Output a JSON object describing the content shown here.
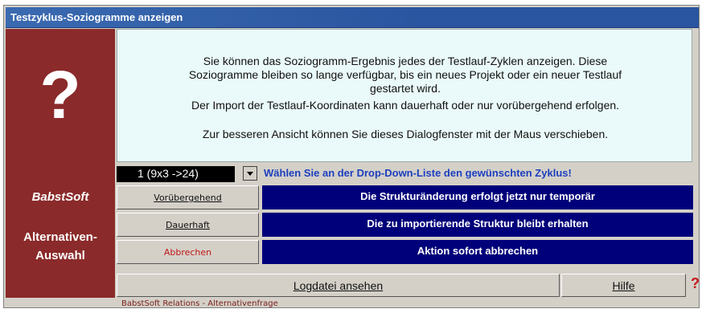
{
  "window": {
    "title": "Testzyklus-Soziogramme anzeigen"
  },
  "sidebar": {
    "symbol": "?",
    "brand": "BabstSoft",
    "caption_line1": "Alternativen-",
    "caption_line2": "Auswahl"
  },
  "info": {
    "line1": "Sie können das Soziogramm-Ergebnis jedes der Testlauf-Zyklen anzeigen. Diese",
    "line2": "Soziogramme bleiben so lange verfügbar, bis ein neues Projekt oder ein neuer Testlauf",
    "line3": "gestartet wird.",
    "line4": "Der Import der Testlauf-Koordinaten kann dauerhaft oder nur vorübergehend erfolgen.",
    "line5": "Zur besseren Ansicht können Sie dieses Dialogfenster mit der Maus verschieben."
  },
  "dropdown": {
    "value": "1 (9x3 ->24)",
    "hint": "Wählen Sie an der Drop-Down-Liste den gewünschten Zyklus!"
  },
  "actions": [
    {
      "label": "Vorübergehend",
      "desc": "Die Strukturänderung erfolgt jetzt nur temporär"
    },
    {
      "label": "Dauerhaft",
      "desc": "Die zu importierende Struktur bleibt erhalten"
    },
    {
      "label": "Abbrechen",
      "desc": "Aktion sofort abbrechen"
    }
  ],
  "footer": {
    "log_label": "Logdatei ansehen",
    "help_label": "Hilfe",
    "help_icon": "?"
  },
  "status": {
    "text": "BabstSoft Relations - Alternativenfrage"
  },
  "colors": {
    "title_bar": "#2a55a0",
    "sidebar": "#8b2a2a",
    "band": "#00007a",
    "info_bg": "#eaf9f9",
    "cancel_text": "#c01818"
  }
}
